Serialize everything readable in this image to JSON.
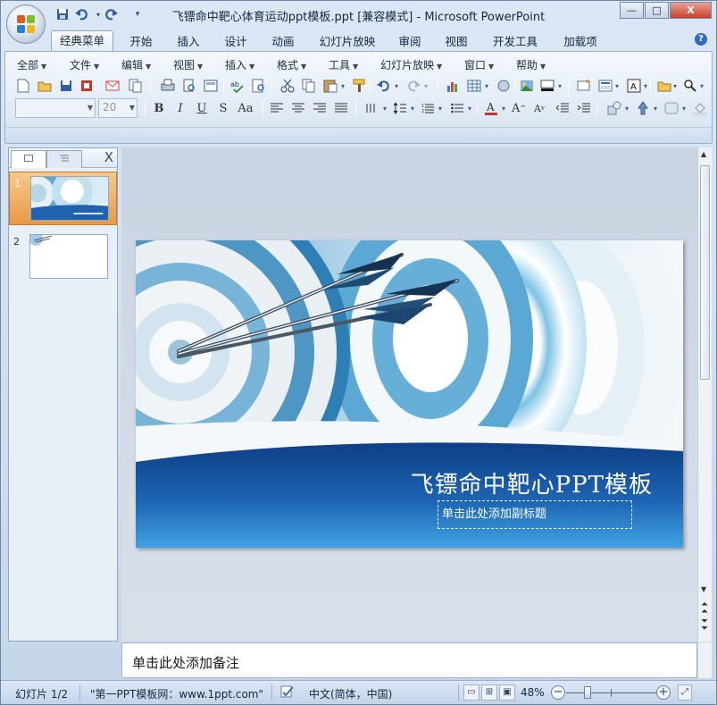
{
  "window": {
    "title": "飞镖命中靶心体育运动ppt模板.ppt [兼容模式] - Microsoft PowerPoint",
    "minimize_label": "—",
    "maximize_label": "□",
    "close_label": "X"
  },
  "quick_access": [
    "save-icon",
    "undo-icon",
    "redo-icon",
    "customize-icon"
  ],
  "tabs": [
    "经典菜单",
    "开始",
    "插入",
    "设计",
    "动画",
    "幻灯片放映",
    "审阅",
    "视图",
    "开发工具",
    "加载项"
  ],
  "active_tab": "经典菜单",
  "menus": [
    "全部",
    "文件",
    "编辑",
    "视图",
    "插入",
    "格式",
    "工具",
    "幻灯片放映",
    "窗口",
    "帮助"
  ],
  "toolbar": {
    "font_size_value": "20",
    "font_name_value": ""
  },
  "panel": {
    "slides_tab_icon": "slides-icon",
    "outline_tab_icon": "outline-icon",
    "close_label": "X"
  },
  "slides": [
    {
      "number": "1",
      "selected": true
    },
    {
      "number": "2",
      "selected": false
    }
  ],
  "slide": {
    "title": "飞镖命中靶心PPT模板",
    "subtitle": "单击此处添加副标题"
  },
  "notes": {
    "placeholder": "单击此处添加备注"
  },
  "status": {
    "slide_counter": "幻灯片 1/2",
    "theme": "\"第一PPT模板网：www.1ppt.com\"",
    "language": "中文(简体，中国)",
    "zoom": "48%",
    "zoom_fraction": 0.48
  },
  "colors": {
    "accent": "#2e6fb8",
    "selected_thumb": "#e89a45",
    "slide_blue": "#1f63b0"
  }
}
